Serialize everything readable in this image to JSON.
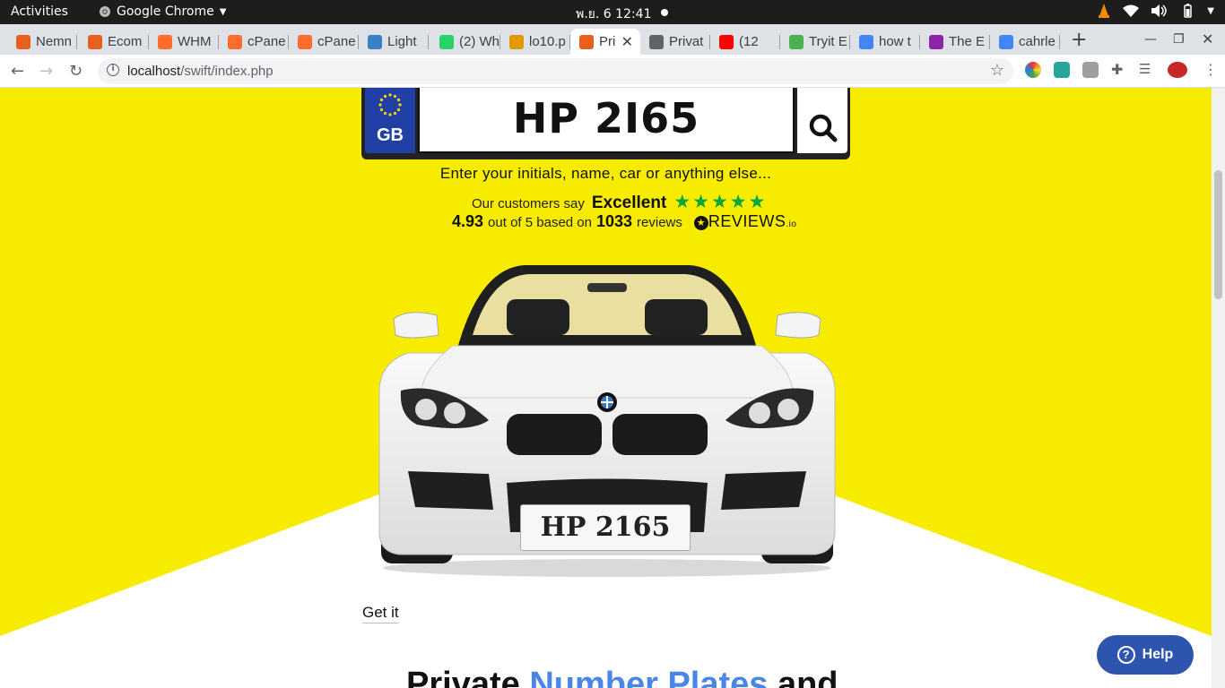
{
  "topbar": {
    "activities": "Activities",
    "app_name": "Google Chrome",
    "clock": "พ.ย. 6  12:41"
  },
  "tabs": [
    {
      "label": "Nemn",
      "color": "#e8601c"
    },
    {
      "label": "Ecom",
      "color": "#e8601c"
    },
    {
      "label": "WHM",
      "color": "#ff6c2c"
    },
    {
      "label": "cPane",
      "color": "#ff6c2c"
    },
    {
      "label": "cPane",
      "color": "#ff6c2c"
    },
    {
      "label": "Light",
      "color": "#3b7fc4"
    },
    {
      "label": "(2) Wh",
      "color": "#25d366"
    },
    {
      "label": "lo10.p",
      "color": "#e09a00"
    },
    {
      "label": "Pri",
      "color": "#e8601c",
      "active": true
    },
    {
      "label": "Privat",
      "color": "#5f6368"
    },
    {
      "label": "(12",
      "color": "#ff0000"
    },
    {
      "label": "Tryit E",
      "color": "#4caf50"
    },
    {
      "label": "how t",
      "color": "#4285f4"
    },
    {
      "label": "The E",
      "color": "#8e24aa"
    },
    {
      "label": "cahrle",
      "color": "#4285f4"
    }
  ],
  "addressbar": {
    "host": "localhost",
    "path": "/swift/index.php"
  },
  "page": {
    "plate_country": "GB",
    "plate_value": "HP 2I65",
    "hint": "Enter your initials, name, car or anything else...",
    "reviews": {
      "prefix": "Our customers say",
      "rating_word": "Excellent",
      "stars": "★★★★★",
      "score": "4.93",
      "out_of": "out of 5 based on",
      "count": "1033",
      "reviews_word": "reviews",
      "logo_text": "REVIEWS",
      "logo_suffix": ".io"
    },
    "car_plate": "HP 2165",
    "get_it": "Get it",
    "headline_start": "Private ",
    "headline_highlight": "Number Plates",
    "headline_end": " and",
    "help": "Help"
  },
  "colors": {
    "hero_yellow": "#f7ec00",
    "eu_blue": "#2140a6",
    "accent_blue": "#4a86e8",
    "help_blue": "#2d55b0"
  }
}
